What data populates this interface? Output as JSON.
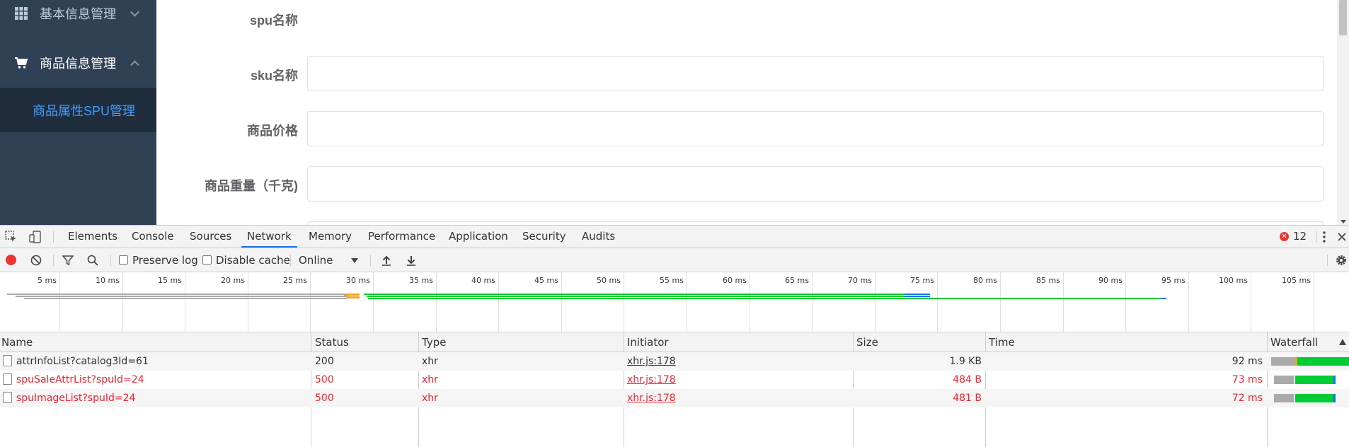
{
  "sidebar": {
    "basic_label": "基本信息管理",
    "goods_label": "商品信息管理",
    "sub_label": "商品属性SPU管理"
  },
  "form": {
    "spu_label": "spu名称",
    "sku_label": "sku名称",
    "price_label": "商品价格",
    "weight_label": "商品重量（千克)"
  },
  "devtools": {
    "tabs": [
      "Elements",
      "Console",
      "Sources",
      "Network",
      "Memory",
      "Performance",
      "Application",
      "Security",
      "Audits"
    ],
    "active_tab": "Network",
    "error_count": "12",
    "toolbar": {
      "preserve_log": "Preserve log",
      "disable_cache": "Disable cache",
      "throttling": "Online"
    },
    "timeline_ticks": [
      "5 ms",
      "10 ms",
      "15 ms",
      "20 ms",
      "25 ms",
      "30 ms",
      "35 ms",
      "40 ms",
      "45 ms",
      "50 ms",
      "55 ms",
      "60 ms",
      "65 ms",
      "70 ms",
      "75 ms",
      "80 ms",
      "85 ms",
      "90 ms",
      "95 ms",
      "100 ms",
      "105 ms"
    ],
    "columns": {
      "name": "Name",
      "status": "Status",
      "type": "Type",
      "initiator": "Initiator",
      "size": "Size",
      "time": "Time",
      "waterfall": "Waterfall"
    },
    "requests": [
      {
        "name": "attrInfoList?catalog3Id=61",
        "status": "200",
        "type": "xhr",
        "initiator": "xhr.js:178",
        "size": "1.9 KB",
        "time": "92 ms",
        "error": false
      },
      {
        "name": "spuSaleAttrList?spuId=24",
        "status": "500",
        "type": "xhr",
        "initiator": "xhr.js:178",
        "size": "484 B",
        "time": "73 ms",
        "error": true
      },
      {
        "name": "spuImageList?spuId=24",
        "status": "500",
        "type": "xhr",
        "initiator": "xhr.js:178",
        "size": "481 B",
        "time": "72 ms",
        "error": true
      }
    ]
  },
  "colors": {
    "sidebar_bg": "#304156",
    "submenu_bg": "#1f2d3d",
    "accent": "#409eff",
    "error_red": "#e23",
    "waterfall_green": "#0c3",
    "waterfall_blue": "#1a73e8"
  }
}
